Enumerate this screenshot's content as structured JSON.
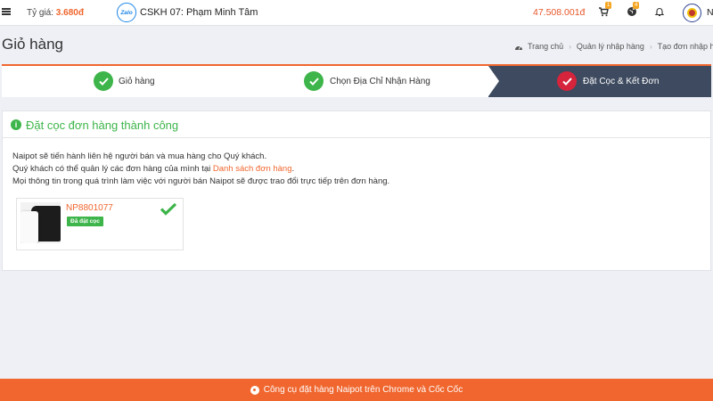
{
  "topbar": {
    "rate_label": "Tỷ giá: ",
    "rate_value": "3.680đ",
    "zalo_label": "Zalo",
    "cskh": "CSKH 07: Phạm Minh Tâm",
    "balance": "47.508.001đ",
    "cart_count": "1",
    "globe_count": "4",
    "user_initial": "N"
  },
  "header": {
    "title": "Giỏ hàng",
    "breadcrumb": [
      "Trang chủ",
      "Quản lý nhập hàng",
      "Tạo đơn nhập hà"
    ]
  },
  "steps": [
    {
      "label": "Giỏ hàng"
    },
    {
      "label": "Chọn Địa Chỉ Nhận Hàng"
    },
    {
      "label": "Đặt Cọc & Kết Đơn"
    }
  ],
  "panel": {
    "title": "Đặt cọc đơn hàng thành công",
    "line1": "Naipot sẽ tiến hành liên hệ người bán và mua hàng cho Quý khách.",
    "line2_prefix": "Quý khách có thể quản lý các đơn hàng của mình tại ",
    "line2_link": "Danh sách đơn hàng",
    "line2_suffix": ".",
    "line3": "Mọi thông tin trong quá trình làm việc với người bán Naipot sẽ được trao đổi trực tiếp trên đơn hàng."
  },
  "order": {
    "code": "NP8801077",
    "status": "Đã đặt cọc"
  },
  "footer": {
    "text": "Công cụ đặt hàng Naipot trên Chrome và Cốc Cốc"
  },
  "colors": {
    "accent": "#f0662e",
    "success": "#3db54a",
    "active_step": "#3d4a5f",
    "active_check": "#d5243b"
  }
}
